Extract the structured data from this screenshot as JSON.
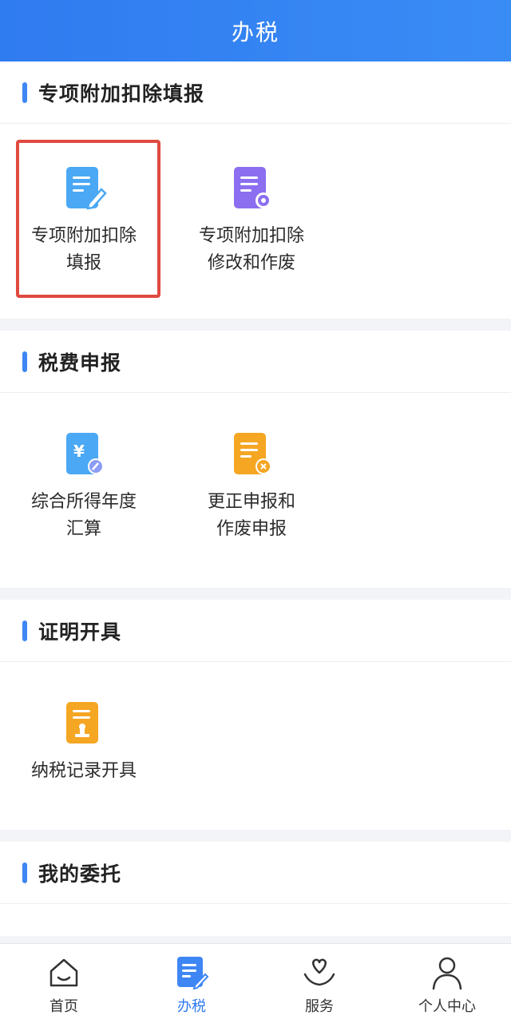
{
  "header": {
    "title": "办税"
  },
  "sections": [
    {
      "title": "专项附加扣除填报",
      "tiles": [
        {
          "label": "专项附加扣除\n填报",
          "icon": "edit-document-icon",
          "color": "#4aa8f5"
        },
        {
          "label": "专项附加扣除\n修改和作废",
          "icon": "document-settings-icon",
          "color": "#8b6ff0"
        }
      ]
    },
    {
      "title": "税费申报",
      "tiles": [
        {
          "label": "综合所得年度\n汇算",
          "icon": "yuan-document-icon",
          "color": "#4aa8f5"
        },
        {
          "label": "更正申报和\n作废申报",
          "icon": "document-cancel-icon",
          "color": "#f5a623"
        }
      ]
    },
    {
      "title": "证明开具",
      "tiles": [
        {
          "label": "纳税记录开具",
          "icon": "stamp-document-icon",
          "color": "#f5a623"
        }
      ]
    },
    {
      "title": "我的委托",
      "tiles": []
    }
  ],
  "tabbar": {
    "items": [
      {
        "label": "首页",
        "icon": "home-icon",
        "active": false
      },
      {
        "label": "办税",
        "icon": "tax-document-icon",
        "active": true
      },
      {
        "label": "服务",
        "icon": "heart-hands-icon",
        "active": false
      },
      {
        "label": "个人中心",
        "icon": "person-icon",
        "active": false
      }
    ]
  },
  "colors": {
    "accent": "#2f7bf0",
    "highlight": "#e04a3f"
  }
}
